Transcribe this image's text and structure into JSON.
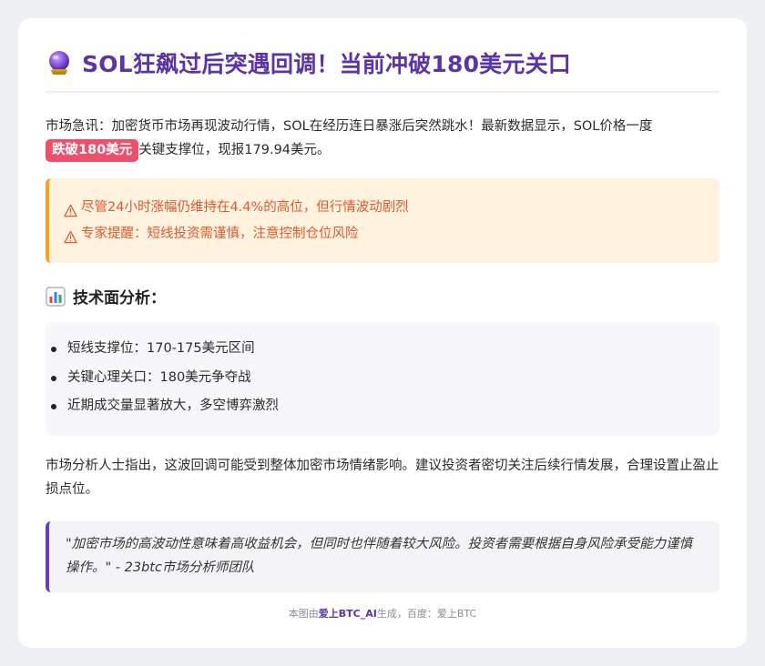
{
  "article": {
    "title": "SOL狂飙过后突遇回调！当前冲破180美元关口",
    "title_icon": "crystal-ball-icon",
    "intro_before": "市场急讯：加密货币市场再现波动行情，SOL在经历连日暴涨后突然跳水！最新数据显示，SOL价格一度",
    "intro_highlight": "跌破180美元",
    "intro_after": "关键支撑位，现报179.94美元。",
    "alerts": [
      "尽管24小时涨幅仍维持在4.4%的高位，但行情波动剧烈",
      "专家提醒：短线投资需谨慎，注意控制仓位风险"
    ],
    "alert_icon": "warning-icon",
    "section_title": "技术面分析：",
    "section_icon": "bar-chart-icon",
    "analysis": [
      "短线支撑位：170-175美元区间",
      "关键心理关口：180美元争夺战",
      "近期成交量显著放大，多空博弈激烈"
    ],
    "paragraph": "市场分析人士指出，这波回调可能受到整体加密市场情绪影响。建议投资者密切关注后续行情发展，合理设置止盈止损点位。",
    "quote": "\"加密市场的高波动性意味着高收益机会，但同时也伴随着较大风险。投资者需要根据自身风险承受能力谨慎操作。\" - 23btc市场分析师团队"
  },
  "footer": {
    "prefix": "本图由",
    "brand": "爱上BTC_AI",
    "suffix": "生成，百度：爱上BTC"
  },
  "colors": {
    "title": "#5b34a8",
    "highlight": "#f04f6c",
    "alert_text": "#e0582c",
    "alert_border": "#ff9f1a",
    "quote_border": "#6a3fb5"
  }
}
